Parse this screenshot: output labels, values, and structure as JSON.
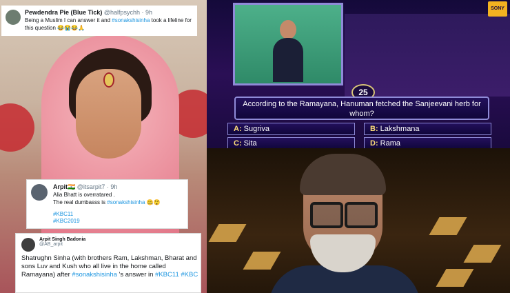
{
  "tweet1": {
    "name": "Pewdendra Pie (Blue Tick)",
    "handle": "@halfpsychh · 9h",
    "text_before": "Being a Muslim I can answer it and ",
    "tag": "#sonakshisinha",
    "text_after": " took a lifeline for this question 😂😭😂🙏"
  },
  "tweet2": {
    "name": "Arpit",
    "flag": "🇮🇳",
    "handle": "@itsarpit7 · 9h",
    "line1": "Alia Bhatt is overratared .",
    "line2_before": "The real dumbasss is ",
    "line2_tag": "#sonakshisinha",
    "line2_after": " 🤐😲",
    "tag1": "#KBC11",
    "tag2": "#KBC2019"
  },
  "tweet3": {
    "name": "Arpit Singh Badonia",
    "handle": "@AB_arpit",
    "text_before": "Shatrughn Sinha (with brothers Ram, Lakshman, Bharat and sons Luv and Kush who all live in the home called Ramayana) after ",
    "tag": "#sonakshisinha",
    "text_after": " 's answer in ",
    "tag2": "#KBC11",
    "tag3": "#KBC"
  },
  "kbc": {
    "question_number": "25",
    "question": "According to the Ramayana, Hanuman fetched the Sanjeevani herb for whom?",
    "options": [
      {
        "letter": "A:",
        "text": "Sugriva"
      },
      {
        "letter": "B:",
        "text": "Lakshmana"
      },
      {
        "letter": "C:",
        "text": "Sita"
      },
      {
        "letter": "D:",
        "text": "Rama"
      }
    ],
    "channel_logo": "SONY"
  },
  "colors": {
    "tweet_link": "#1b95e0",
    "kbc_bg": "#1b0b3f",
    "kbc_border": "#8f8bd8"
  }
}
